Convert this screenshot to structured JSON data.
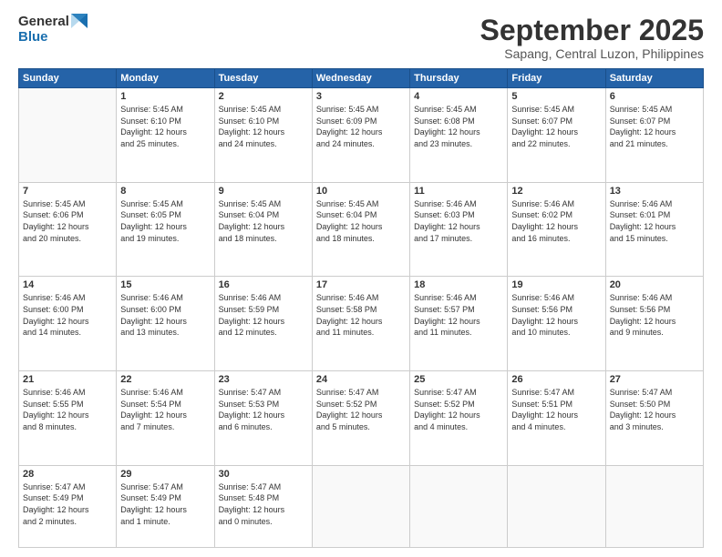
{
  "logo": {
    "line1": "General",
    "line2": "Blue"
  },
  "title": "September 2025",
  "location": "Sapang, Central Luzon, Philippines",
  "days_header": [
    "Sunday",
    "Monday",
    "Tuesday",
    "Wednesday",
    "Thursday",
    "Friday",
    "Saturday"
  ],
  "weeks": [
    [
      {
        "day": "",
        "info": ""
      },
      {
        "day": "1",
        "info": "Sunrise: 5:45 AM\nSunset: 6:10 PM\nDaylight: 12 hours\nand 25 minutes."
      },
      {
        "day": "2",
        "info": "Sunrise: 5:45 AM\nSunset: 6:10 PM\nDaylight: 12 hours\nand 24 minutes."
      },
      {
        "day": "3",
        "info": "Sunrise: 5:45 AM\nSunset: 6:09 PM\nDaylight: 12 hours\nand 24 minutes."
      },
      {
        "day": "4",
        "info": "Sunrise: 5:45 AM\nSunset: 6:08 PM\nDaylight: 12 hours\nand 23 minutes."
      },
      {
        "day": "5",
        "info": "Sunrise: 5:45 AM\nSunset: 6:07 PM\nDaylight: 12 hours\nand 22 minutes."
      },
      {
        "day": "6",
        "info": "Sunrise: 5:45 AM\nSunset: 6:07 PM\nDaylight: 12 hours\nand 21 minutes."
      }
    ],
    [
      {
        "day": "7",
        "info": "Sunrise: 5:45 AM\nSunset: 6:06 PM\nDaylight: 12 hours\nand 20 minutes."
      },
      {
        "day": "8",
        "info": "Sunrise: 5:45 AM\nSunset: 6:05 PM\nDaylight: 12 hours\nand 19 minutes."
      },
      {
        "day": "9",
        "info": "Sunrise: 5:45 AM\nSunset: 6:04 PM\nDaylight: 12 hours\nand 18 minutes."
      },
      {
        "day": "10",
        "info": "Sunrise: 5:45 AM\nSunset: 6:04 PM\nDaylight: 12 hours\nand 18 minutes."
      },
      {
        "day": "11",
        "info": "Sunrise: 5:46 AM\nSunset: 6:03 PM\nDaylight: 12 hours\nand 17 minutes."
      },
      {
        "day": "12",
        "info": "Sunrise: 5:46 AM\nSunset: 6:02 PM\nDaylight: 12 hours\nand 16 minutes."
      },
      {
        "day": "13",
        "info": "Sunrise: 5:46 AM\nSunset: 6:01 PM\nDaylight: 12 hours\nand 15 minutes."
      }
    ],
    [
      {
        "day": "14",
        "info": "Sunrise: 5:46 AM\nSunset: 6:00 PM\nDaylight: 12 hours\nand 14 minutes."
      },
      {
        "day": "15",
        "info": "Sunrise: 5:46 AM\nSunset: 6:00 PM\nDaylight: 12 hours\nand 13 minutes."
      },
      {
        "day": "16",
        "info": "Sunrise: 5:46 AM\nSunset: 5:59 PM\nDaylight: 12 hours\nand 12 minutes."
      },
      {
        "day": "17",
        "info": "Sunrise: 5:46 AM\nSunset: 5:58 PM\nDaylight: 12 hours\nand 11 minutes."
      },
      {
        "day": "18",
        "info": "Sunrise: 5:46 AM\nSunset: 5:57 PM\nDaylight: 12 hours\nand 11 minutes."
      },
      {
        "day": "19",
        "info": "Sunrise: 5:46 AM\nSunset: 5:56 PM\nDaylight: 12 hours\nand 10 minutes."
      },
      {
        "day": "20",
        "info": "Sunrise: 5:46 AM\nSunset: 5:56 PM\nDaylight: 12 hours\nand 9 minutes."
      }
    ],
    [
      {
        "day": "21",
        "info": "Sunrise: 5:46 AM\nSunset: 5:55 PM\nDaylight: 12 hours\nand 8 minutes."
      },
      {
        "day": "22",
        "info": "Sunrise: 5:46 AM\nSunset: 5:54 PM\nDaylight: 12 hours\nand 7 minutes."
      },
      {
        "day": "23",
        "info": "Sunrise: 5:47 AM\nSunset: 5:53 PM\nDaylight: 12 hours\nand 6 minutes."
      },
      {
        "day": "24",
        "info": "Sunrise: 5:47 AM\nSunset: 5:52 PM\nDaylight: 12 hours\nand 5 minutes."
      },
      {
        "day": "25",
        "info": "Sunrise: 5:47 AM\nSunset: 5:52 PM\nDaylight: 12 hours\nand 4 minutes."
      },
      {
        "day": "26",
        "info": "Sunrise: 5:47 AM\nSunset: 5:51 PM\nDaylight: 12 hours\nand 4 minutes."
      },
      {
        "day": "27",
        "info": "Sunrise: 5:47 AM\nSunset: 5:50 PM\nDaylight: 12 hours\nand 3 minutes."
      }
    ],
    [
      {
        "day": "28",
        "info": "Sunrise: 5:47 AM\nSunset: 5:49 PM\nDaylight: 12 hours\nand 2 minutes."
      },
      {
        "day": "29",
        "info": "Sunrise: 5:47 AM\nSunset: 5:49 PM\nDaylight: 12 hours\nand 1 minute."
      },
      {
        "day": "30",
        "info": "Sunrise: 5:47 AM\nSunset: 5:48 PM\nDaylight: 12 hours\nand 0 minutes."
      },
      {
        "day": "",
        "info": ""
      },
      {
        "day": "",
        "info": ""
      },
      {
        "day": "",
        "info": ""
      },
      {
        "day": "",
        "info": ""
      }
    ]
  ]
}
